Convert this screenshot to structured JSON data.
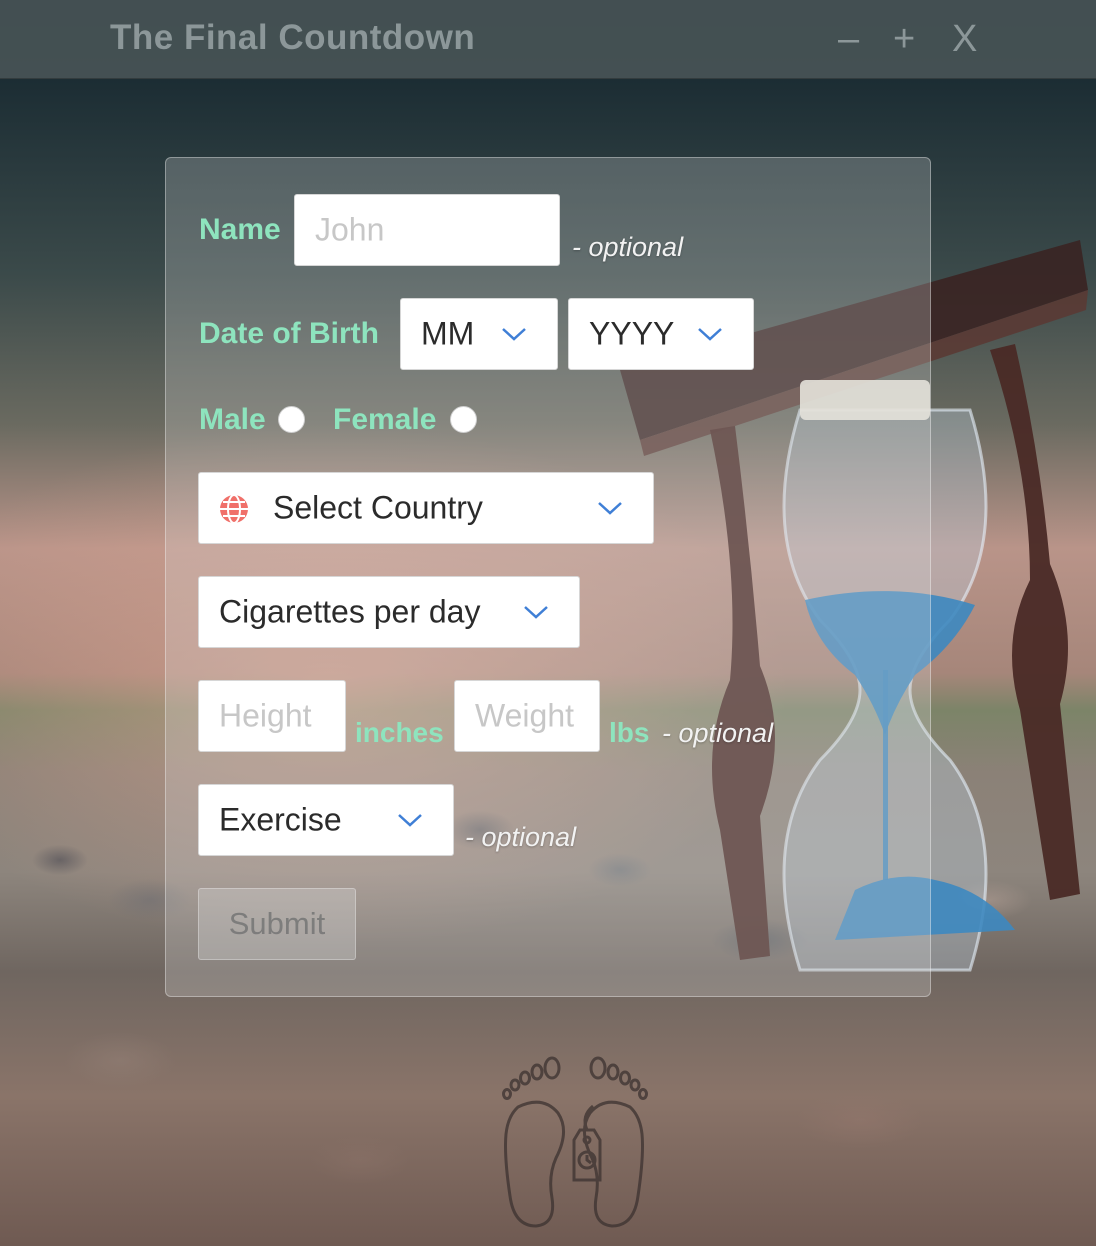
{
  "window": {
    "title": "The Final Countdown",
    "minimize": "–",
    "maximize": "+",
    "close": "X"
  },
  "form": {
    "name": {
      "label": "Name",
      "placeholder": "John",
      "hint": "- optional"
    },
    "dob": {
      "label": "Date of Birth",
      "month": "MM",
      "year": "YYYY"
    },
    "gender": {
      "male": "Male",
      "female": "Female"
    },
    "country": {
      "value": "Select Country",
      "icon": "globe-icon"
    },
    "cigarettes": {
      "value": "Cigarettes per day"
    },
    "height": {
      "placeholder": "Height",
      "unit": "inches"
    },
    "weight": {
      "placeholder": "Weight",
      "unit": "lbs",
      "hint": "- optional"
    },
    "exercise": {
      "value": "Exercise",
      "hint": "- optional"
    },
    "submit": "Submit"
  },
  "colors": {
    "label_accent": "#8ee4be",
    "chevron": "#3f7fd6",
    "globe": "#f0706a"
  },
  "logo": {
    "icon": "footprints-toe-tag-icon"
  }
}
